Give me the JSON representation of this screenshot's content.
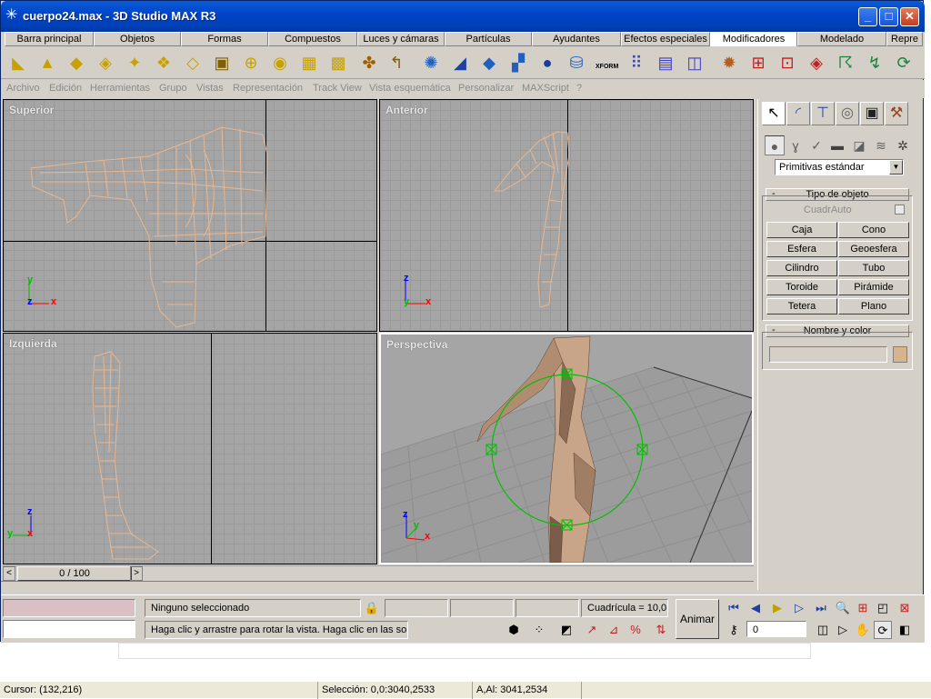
{
  "window": {
    "title": "cuerpo24.max - 3D Studio MAX R3"
  },
  "tabs": [
    {
      "label": "Barra principal"
    },
    {
      "label": "Objetos"
    },
    {
      "label": "Formas"
    },
    {
      "label": "Compuestos"
    },
    {
      "label": "Luces y cámaras"
    },
    {
      "label": "Partículas"
    },
    {
      "label": "Ayudantes"
    },
    {
      "label": "Efectos especiales"
    },
    {
      "label": "Modificadores"
    },
    {
      "label": "Modelado"
    },
    {
      "label": "Repre"
    }
  ],
  "menu": [
    {
      "label": "Archivo"
    },
    {
      "label": "Edición"
    },
    {
      "label": "Herramientas"
    },
    {
      "label": "Grupo"
    },
    {
      "label": "Vistas"
    },
    {
      "label": "Representación"
    },
    {
      "label": "Track View"
    },
    {
      "label": "Vista esquemática"
    },
    {
      "label": "Personalizar"
    },
    {
      "label": "MAXScript"
    },
    {
      "label": "?"
    }
  ],
  "toolbar": {
    "xform_label": "XFORM"
  },
  "viewports": {
    "top": {
      "label": "Superior",
      "axis_y": "y",
      "axis_z": "z",
      "axis_x": "x"
    },
    "front": {
      "label": "Anterior",
      "axis_z": "z",
      "axis_y": "y",
      "axis_x": "x"
    },
    "left": {
      "label": "Izquierda",
      "axis_z": "z",
      "axis_y": "y",
      "axis_x": "x"
    },
    "persp": {
      "label": "Perspectiva",
      "axis_z": "z",
      "axis_y": "y",
      "axis_x": "x"
    }
  },
  "command_panel": {
    "dropdown_value": "Primitivas estándar",
    "object_type": {
      "header": "Tipo de objeto",
      "autogrid_label": "CuadrAuto",
      "buttons": [
        "Caja",
        "Cono",
        "Esfera",
        "Geoesfera",
        "Cilindro",
        "Tubo",
        "Toroide",
        "Pirámide",
        "Tetera",
        "Plano"
      ]
    },
    "name_color": {
      "header": "Nombre y color",
      "color": "#d8b48c"
    },
    "rollout_minus": "-"
  },
  "timeslider": {
    "frame_text": "0 / 100",
    "prev_arrow": "<",
    "next_arrow": ">"
  },
  "status": {
    "selection": "Ninguno seleccionado",
    "prompt": "Haga clic y arrastre para rotar la vista. Haga clic en las solap",
    "grid": "Cuadrícula = 10,0",
    "animate_button": "Animar",
    "frame_value": "0"
  },
  "outer_status": {
    "cursor": "Cursor: (132,216)",
    "selection": "Selección: 0,0:3040,2533",
    "size": "A,Al: 3041,2534"
  },
  "colors": {
    "title_bar": "#0046c8",
    "viewport_bg": "#a5a5a5",
    "model_wire": "#e8b890",
    "gizmo": "#00c000",
    "axis_x": "#ff0000",
    "axis_y": "#00c000",
    "axis_z": "#0000ff"
  }
}
